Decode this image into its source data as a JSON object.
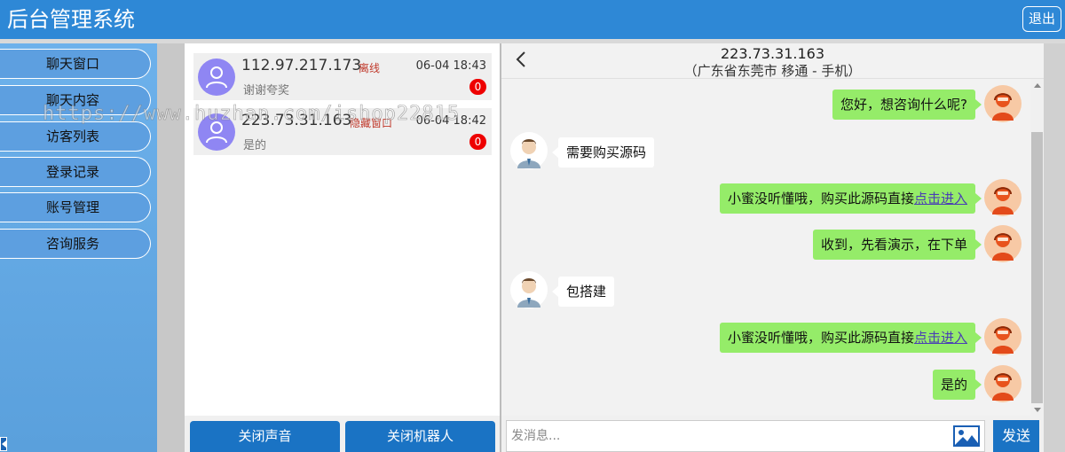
{
  "app": {
    "title": "后台管理系统",
    "logout_label": "退出"
  },
  "sidebar": {
    "items": [
      {
        "label": "聊天窗口"
      },
      {
        "label": "聊天内容"
      },
      {
        "label": "访客列表"
      },
      {
        "label": "登录记录"
      },
      {
        "label": "账号管理"
      },
      {
        "label": "咨询服务"
      }
    ]
  },
  "conversations": [
    {
      "ip": "112.97.217.173",
      "status": "离线",
      "time": "06-04 18:43",
      "preview": "谢谢夸奖",
      "unread": "0"
    },
    {
      "ip": "223.73.31.163",
      "status": "隐藏窗口",
      "time": "06-04 18:42",
      "preview": "是的",
      "unread": "0"
    }
  ],
  "footer": {
    "mute_label": "关闭声音",
    "robot_label": "关闭机器人"
  },
  "chat": {
    "ip": "223.73.31.163",
    "location": "（广东省东莞市 移通 - 手机）",
    "messages": [
      {
        "from": "agent",
        "text": "您好，想咨询什么呢?"
      },
      {
        "from": "visitor",
        "text": "需要购买源码"
      },
      {
        "from": "agent",
        "text": "小蜜没听懂哦，购买此源码直接",
        "link": "点击进入"
      },
      {
        "from": "agent",
        "text": "收到，先看演示，在下单"
      },
      {
        "from": "visitor",
        "text": "包搭建"
      },
      {
        "from": "agent",
        "text": "小蜜没听懂哦，购买此源码直接",
        "link": "点击进入"
      },
      {
        "from": "agent",
        "text": "是的"
      }
    ]
  },
  "composer": {
    "placeholder": "发消息...",
    "send_label": "发送"
  },
  "watermark": "https://www.huzhan.com/ishop22815",
  "colors": {
    "header": "#2e88d6",
    "accent": "#1a73c4",
    "agent_bubble": "#95ec69",
    "badge": "#ee0000"
  }
}
